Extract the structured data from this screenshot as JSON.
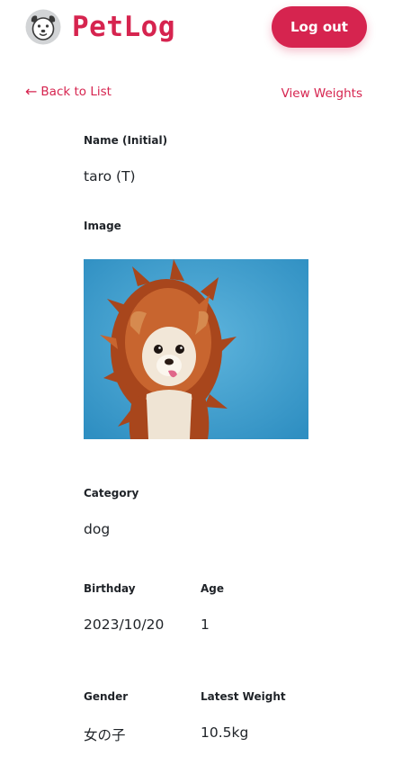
{
  "header": {
    "brand": "PetLog",
    "logo_icon": "dog-face-icon",
    "logout_label": "Log out",
    "accent_color": "#d6244f"
  },
  "nav": {
    "back_arrow": "←",
    "back_label": "Back to List",
    "weights_label": "View Weights"
  },
  "pet": {
    "name_label": "Name (Initial)",
    "name_value": "taro (T)",
    "image_label": "Image",
    "image_subject": "chihuahua-in-lion-mane-costume",
    "category_label": "Category",
    "category_value": "dog",
    "birthday_label": "Birthday",
    "birthday_value": "2023/10/20",
    "age_label": "Age",
    "age_value": "1",
    "gender_label": "Gender",
    "gender_value": "女の子",
    "weight_label": "Latest Weight",
    "weight_value": "10.5kg"
  }
}
